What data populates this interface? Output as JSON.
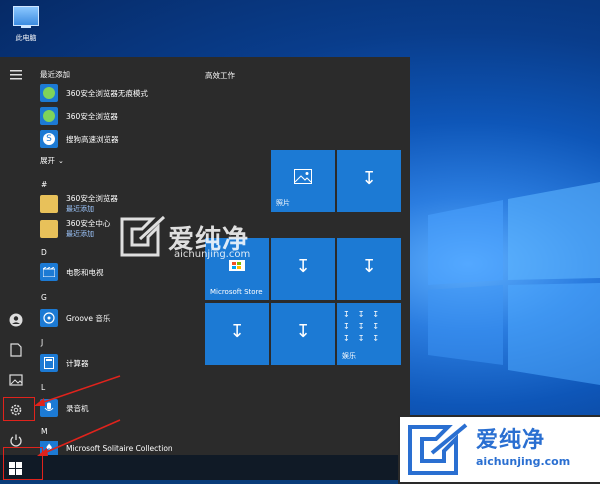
{
  "desktop": {
    "this_pc_label": "此电脑"
  },
  "start_menu": {
    "recent_title": "最近添加",
    "recent_apps": [
      {
        "name": "360安全浏览器无痕模式",
        "icon": "360-browser-icon"
      },
      {
        "name": "360安全浏览器",
        "icon": "360-browser-icon"
      },
      {
        "name": "搜狗高速浏览器",
        "icon": "sogou-browser-icon"
      }
    ],
    "expand_label": "展开",
    "groups": [
      {
        "letter": "#",
        "items": [
          {
            "name": "360安全浏览器",
            "sub": "最近添加"
          },
          {
            "name": "360安全中心",
            "sub": "最近添加"
          }
        ]
      },
      {
        "letter": "D",
        "items": [
          {
            "name": "电影和电视"
          }
        ]
      },
      {
        "letter": "G",
        "items": [
          {
            "name": "Groove 音乐"
          }
        ]
      },
      {
        "letter": "J",
        "items": [
          {
            "name": "计算器"
          }
        ]
      },
      {
        "letter": "L",
        "items": [
          {
            "name": "录音机"
          }
        ]
      },
      {
        "letter": "M",
        "items": [
          {
            "name": "Microsoft Solitaire Collection"
          }
        ]
      }
    ]
  },
  "tiles": {
    "group_title": "高效工作",
    "photos_label": "照片",
    "store_label": "Microsoft Store",
    "entertainment_label": "娱乐"
  },
  "watermark": {
    "text": "爱纯净",
    "url": "aichunjing.com"
  },
  "colors": {
    "tile": "#1c7ad4",
    "menu_bg": "#2b2b2b",
    "annotation": "#e0231c"
  }
}
